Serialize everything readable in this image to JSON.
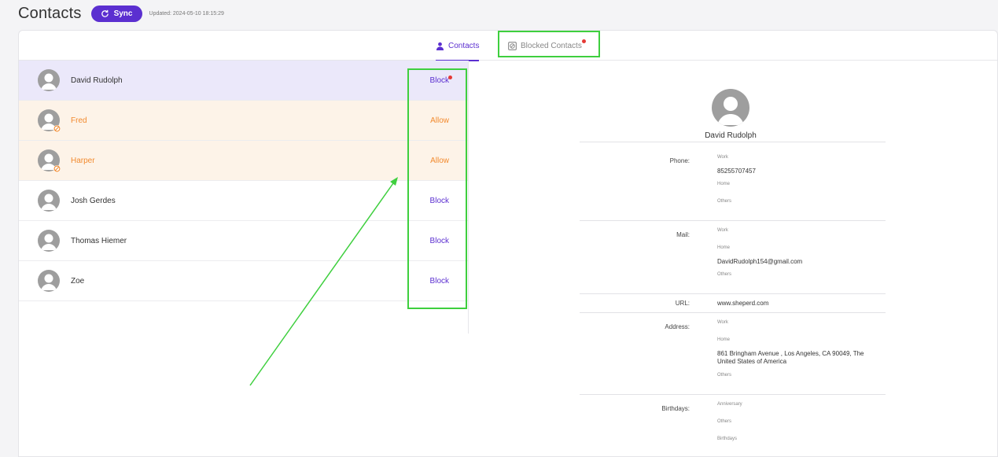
{
  "header": {
    "title": "Contacts",
    "sync_label": "Sync",
    "updated": "Updated: 2024-05-10 18:15:29"
  },
  "tabs": {
    "contacts": "Contacts",
    "blocked": "Blocked Contacts"
  },
  "contacts": [
    {
      "name": "David Rudolph",
      "action": "Block",
      "state": "selected"
    },
    {
      "name": "Fred",
      "action": "Allow",
      "state": "blocked"
    },
    {
      "name": "Harper",
      "action": "Allow",
      "state": "blocked"
    },
    {
      "name": "Josh Gerdes",
      "action": "Block",
      "state": "normal"
    },
    {
      "name": "Thomas Hiemer",
      "action": "Block",
      "state": "normal"
    },
    {
      "name": "Zoe",
      "action": "Block",
      "state": "normal"
    }
  ],
  "detail": {
    "name": "David Rudolph",
    "phone_label": "Phone:",
    "phone_work_label": "Work",
    "phone_work": "85255707457",
    "phone_home_label": "Home",
    "phone_others_label": "Others",
    "mail_label": "Mail:",
    "mail_work_label": "Work",
    "mail_home_label": "Home",
    "mail_home": "DavidRudolph154@gmail.com",
    "mail_others_label": "Others",
    "url_label": "URL:",
    "url": "www.sheperd.com",
    "address_label": "Address:",
    "address_work_label": "Work",
    "address_home_label": "Home",
    "address_home": "861 Bringham Avenue , Los Angeles, CA 90049, The United States of America",
    "address_others_label": "Others",
    "birthdays_label": "Birthdays:",
    "anniversary_label": "Anniversary",
    "bday_others_label": "Others",
    "bday_birthdays_label": "Birthdays"
  },
  "colors": {
    "accent": "#5b2fd0",
    "blocked": "#f28a2e",
    "annotation": "#3ecf3e",
    "notification": "#e53935"
  }
}
